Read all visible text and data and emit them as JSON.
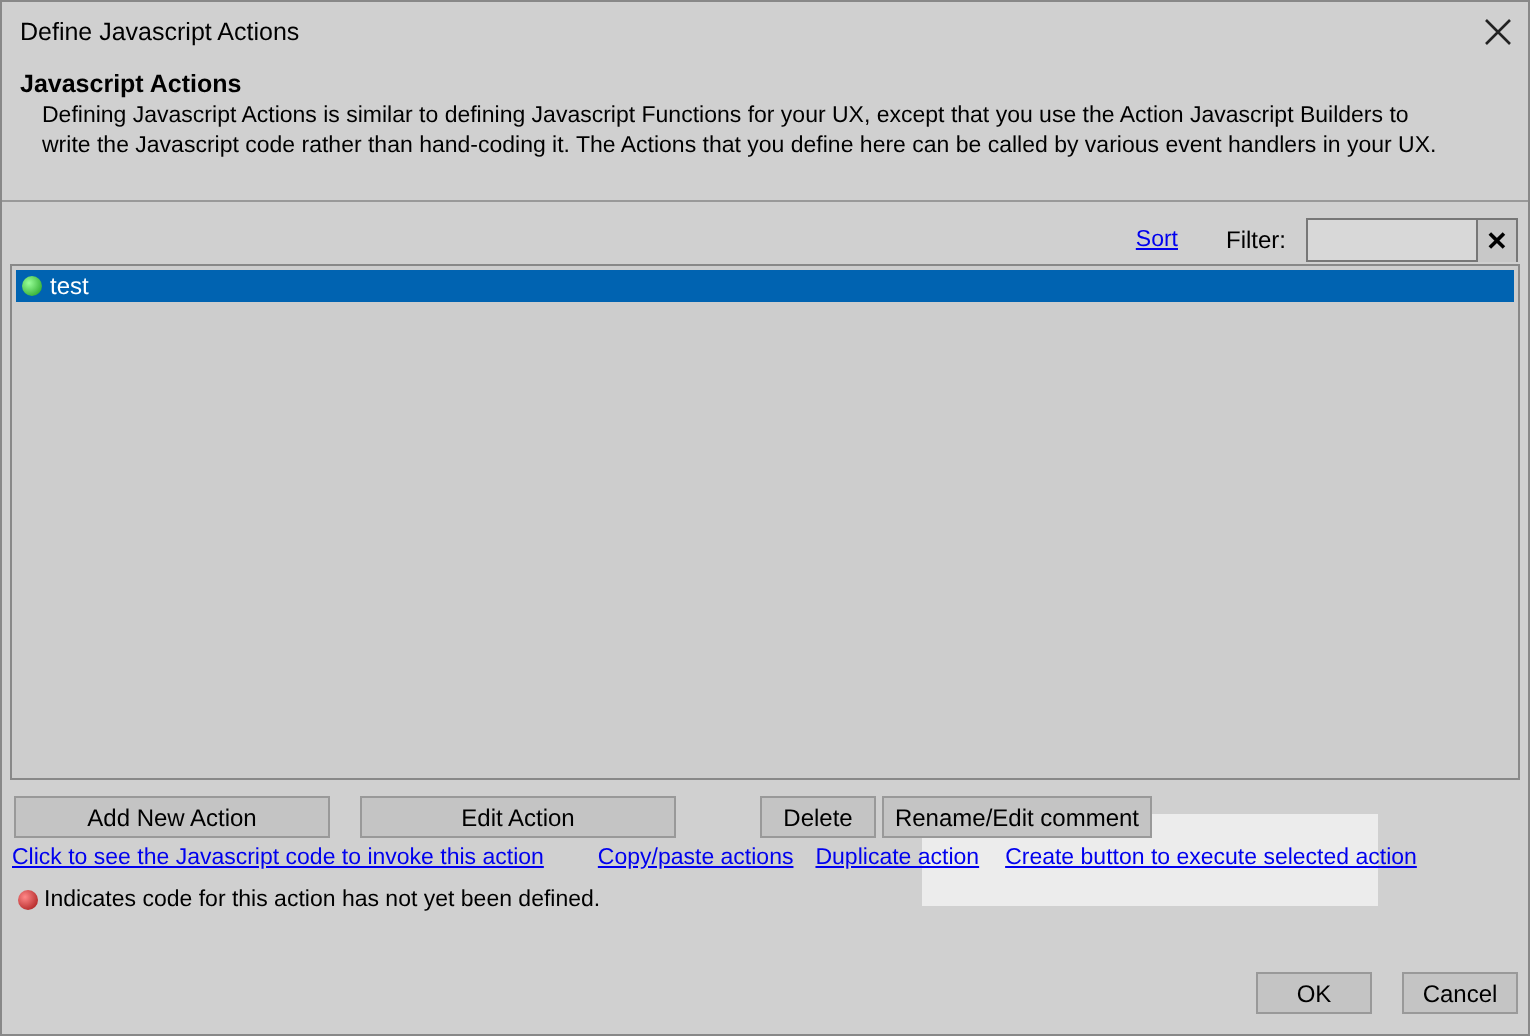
{
  "window": {
    "title": "Define Javascript Actions"
  },
  "header": {
    "title": "Javascript Actions",
    "description": "Defining Javascript Actions is similar to defining Javascript Functions for your UX, except that you use the Action Javascript Builders to write the Javascript code rather than hand-coding it. The Actions that you define here can be called by various event handlers in your UX."
  },
  "toolbar": {
    "sort_link": "Sort",
    "filter_label": "Filter:",
    "clear_icon": "✕"
  },
  "actions": [
    {
      "name": "test",
      "selected": true,
      "defined": true
    }
  ],
  "buttons": [
    "Add New Action",
    "Edit Action",
    "Delete",
    "Rename/Edit comment"
  ],
  "links": [
    "Click to see the Javascript code to invoke this action",
    "Copy/paste actions",
    "Duplicate action",
    "Create button to execute selected action"
  ],
  "legend": "Indicates code for this action has not yet been defined.",
  "dialog_buttons": [
    "OK",
    "Cancel"
  ]
}
